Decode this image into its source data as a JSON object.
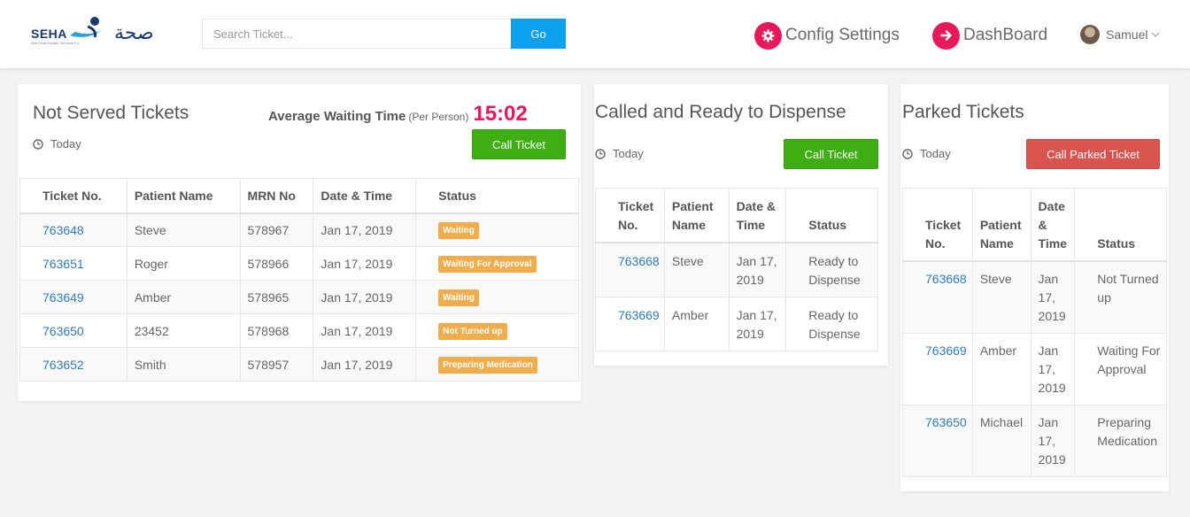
{
  "header": {
    "logo": {
      "text": "SEHA",
      "arabic": "صحة",
      "subtitle": "Abu Dhabi Health Services Co."
    },
    "search": {
      "placeholder": "Search Ticket...",
      "value": "",
      "button_label": "Go"
    },
    "nav": [
      {
        "label": "Config Settings",
        "icon": "gear-icon"
      },
      {
        "label": "DashBoard",
        "icon": "arrow-right-circle-icon"
      }
    ],
    "user": {
      "name": "Samuel",
      "icon": "chevron-down-icon"
    },
    "accent_color": "#e8195b",
    "button_color": "#0ea0f0"
  },
  "not_served": {
    "title": "Not Served Tickets",
    "period": "Today",
    "avg_label": "Average Waiting Time",
    "avg_note": "(Per Person)",
    "avg_value": "15:02",
    "button_label": "Call Ticket",
    "columns": [
      "Ticket No.",
      "Patient Name",
      "MRN No",
      "Date & Time",
      "Status"
    ],
    "rows": [
      {
        "ticket": "763648",
        "patient": "Steve",
        "mrn": "578967",
        "date": "Jan 17, 2019",
        "status": "Waiting"
      },
      {
        "ticket": "763651",
        "patient": "Roger",
        "mrn": "578966",
        "date": "Jan 17, 2019",
        "status": "Waiting For Approval"
      },
      {
        "ticket": "763649",
        "patient": "Amber",
        "mrn": "578965",
        "date": "Jan 17, 2019",
        "status": "Waiting"
      },
      {
        "ticket": "763650",
        "patient": "23452",
        "mrn": "578968",
        "date": "Jan 17, 2019",
        "status": "Not Turned up"
      },
      {
        "ticket": "763652",
        "patient": "Smith",
        "mrn": "578957",
        "date": "Jan 17, 2019",
        "status": "Preparing Medication"
      }
    ],
    "status_color": "#f0ad4e",
    "button_color": "#3fae13"
  },
  "called": {
    "title": "Called and Ready to Dispense",
    "period": "Today",
    "button_label": "Call Ticket",
    "columns": [
      "Ticket No.",
      "Patient Name",
      "Date & Time",
      "Status"
    ],
    "rows": [
      {
        "ticket": "763668",
        "patient": "Steve",
        "date": "Jan 17, 2019",
        "status": "Ready to Dispense"
      },
      {
        "ticket": "763669",
        "patient": "Amber",
        "date": "Jan 17, 2019",
        "status": "Ready to Dispense"
      }
    ]
  },
  "parked": {
    "title": "Parked Tickets",
    "period": "Today",
    "button_label": "Call Parked Ticket",
    "button_color": "#d9534f",
    "columns": [
      "Ticket No.",
      "Patient Name",
      "Date & Time",
      "Status"
    ],
    "rows": [
      {
        "ticket": "763668",
        "patient": "Steve",
        "date": "Jan 17, 2019",
        "status": "Not Turned up"
      },
      {
        "ticket": "763669",
        "patient": "Amber",
        "date": "Jan 17, 2019",
        "status": "Waiting For Approval"
      },
      {
        "ticket": "763650",
        "patient": "Michael",
        "date": "Jan 17, 2019",
        "status": "Preparing Medication"
      }
    ]
  }
}
